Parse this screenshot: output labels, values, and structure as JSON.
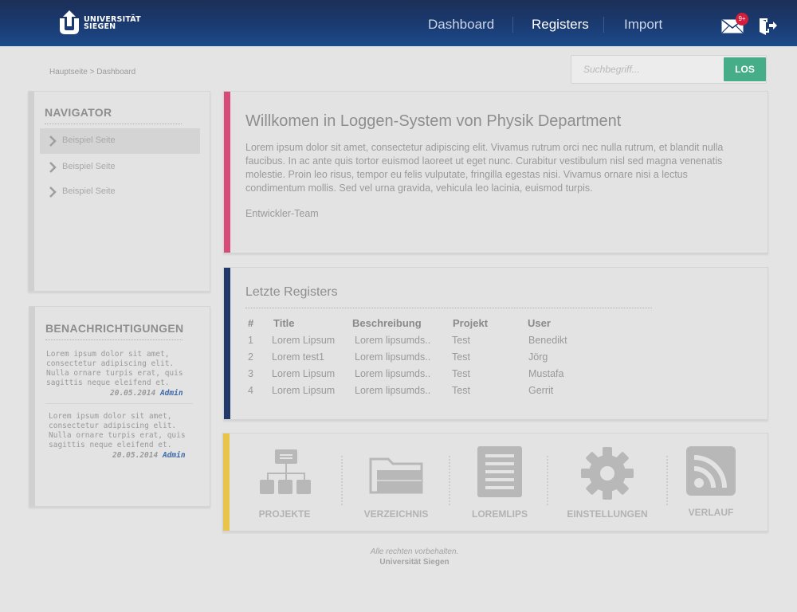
{
  "brand": {
    "line1": "UNIVERSITÄT",
    "line2": "SIEGEN"
  },
  "nav": {
    "items": [
      "Dashboard",
      "Registers",
      "Import"
    ],
    "active": "Registers"
  },
  "header": {
    "mail_badge": "9+"
  },
  "breadcrumb": "Hauptseite > Dashboard",
  "search": {
    "placeholder": "Suchbegriff...",
    "button": "LOS"
  },
  "navigator": {
    "title": "NAVIGATOR",
    "items": [
      "Beispiel Seite",
      "Beispiel Seite",
      "Beispiel Seite"
    ]
  },
  "notifications": {
    "title": "BENACHRICHTIGUNGEN",
    "items": [
      {
        "text": "Lorem ipsum dolor sit amet, consectetur adipiscing elit. Nulla ornare turpis erat, quis sagittis neque eleifend et.",
        "date": "20.05.2014",
        "author": "Admin"
      },
      {
        "text": "Lorem ipsum dolor sit amet, consectetur adipiscing elit. Nulla ornare turpis erat, quis sagittis neque eleifend et.",
        "date": "20.05.2014",
        "author": "Admin"
      }
    ]
  },
  "welcome": {
    "title": "Willkomen in Loggen-System von Physik Department",
    "text": "Lorem ipsum dolor sit amet, consectetur adipiscing elit. Vivamus rutrum orci nec nulla rutrum, et blandit nulla faucibus. In ac ante quis tortor euismod laoreet ut eget nunc. Curabitur vestibulum nisl sed magna venenatis molestie. Proin leo risus, tempor eu felis vulputate, fringilla egestas nisi. Vivamus ornare nisi a lectus condimentum mollis. Sed vel urna gravida, vehicula leo lacinia, euismod turpis.",
    "signature": "Entwickler-Team",
    "accent": "#d84a78"
  },
  "registers": {
    "title": "Letzte Registers",
    "accent": "#23386a",
    "headers": [
      "#",
      "Title",
      "Beschreibung",
      "Projekt",
      "User"
    ],
    "rows": [
      [
        "1",
        "Lorem Lipsum",
        "Lorem lipsumds..",
        "Test",
        "Benedikt"
      ],
      [
        "2",
        "Lorem  test1",
        "Lorem lipsumds..",
        "Test",
        "Jörg"
      ],
      [
        "3",
        "Lorem Lipsum",
        "Lorem lipsumds..",
        "Test",
        "Mustafa"
      ],
      [
        "4",
        "Lorem Lipsum",
        "Lorem lipsumds..",
        "Test",
        "Gerrit"
      ]
    ]
  },
  "shortcuts": {
    "accent": "#e8c54a",
    "items": [
      {
        "label": "PROJEKTE",
        "icon": "sitemap-icon"
      },
      {
        "label": "VERZEICHNIS",
        "icon": "folder-icon"
      },
      {
        "label": "LOREMLIPS",
        "icon": "document-icon"
      },
      {
        "label": "EINSTELLUNGEN",
        "icon": "gear-icon"
      },
      {
        "label": "VERLAUF",
        "icon": "rss-icon"
      }
    ]
  },
  "footer": {
    "line1": "Alle rechten vorbehalten.",
    "line2": "Universität Siegen"
  }
}
